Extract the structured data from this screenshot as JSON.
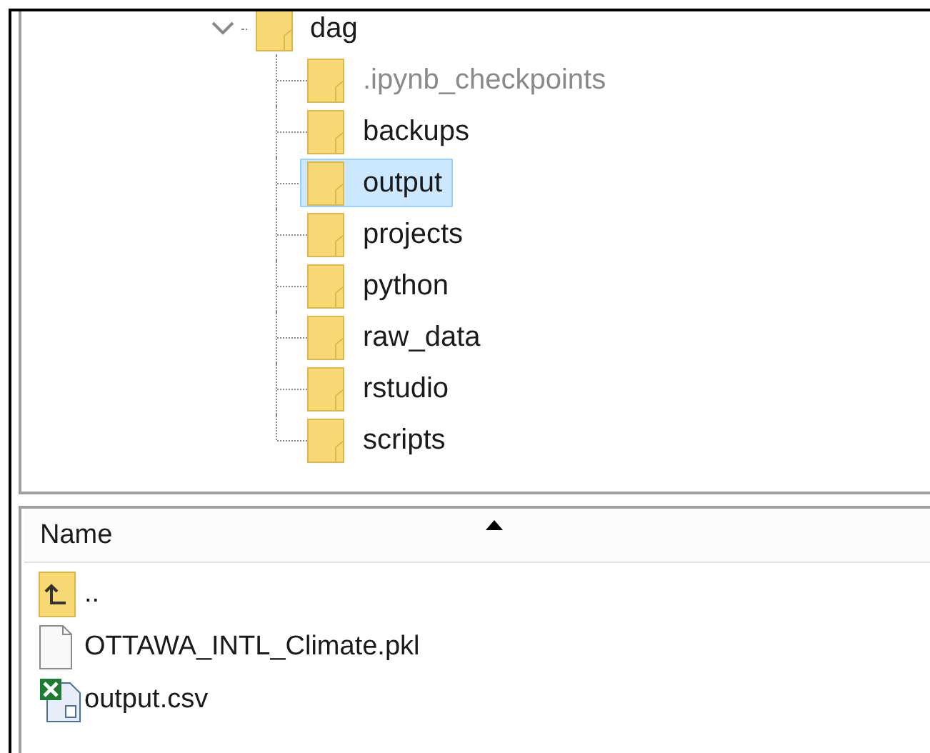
{
  "tree": {
    "label": "dag",
    "expanded": true,
    "children": [
      {
        "label": ".ipynb_checkpoints",
        "selected": false,
        "dimmed": true
      },
      {
        "label": "backups",
        "selected": false,
        "dimmed": false
      },
      {
        "label": "output",
        "selected": true,
        "dimmed": false
      },
      {
        "label": "projects",
        "selected": false,
        "dimmed": false
      },
      {
        "label": "python",
        "selected": false,
        "dimmed": false
      },
      {
        "label": "raw_data",
        "selected": false,
        "dimmed": false
      },
      {
        "label": "rstudio",
        "selected": false,
        "dimmed": false
      },
      {
        "label": "scripts",
        "selected": false,
        "dimmed": false
      }
    ]
  },
  "file_list": {
    "columns": [
      {
        "label": "Name",
        "sort_ascending": true
      }
    ],
    "rows": [
      {
        "kind": "parent",
        "name": ".."
      },
      {
        "kind": "file",
        "name": "OTTAWA_INTL_Climate.pkl"
      },
      {
        "kind": "spreadsheet",
        "name": "output.csv"
      }
    ]
  }
}
